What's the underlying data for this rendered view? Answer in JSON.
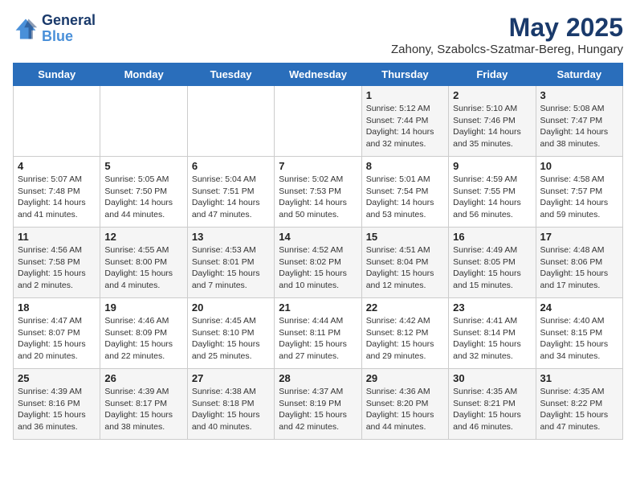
{
  "header": {
    "logo_line1": "General",
    "logo_line2": "Blue",
    "month": "May 2025",
    "location": "Zahony, Szabolcs-Szatmar-Bereg, Hungary"
  },
  "weekdays": [
    "Sunday",
    "Monday",
    "Tuesday",
    "Wednesday",
    "Thursday",
    "Friday",
    "Saturday"
  ],
  "weeks": [
    [
      {
        "day": "",
        "info": ""
      },
      {
        "day": "",
        "info": ""
      },
      {
        "day": "",
        "info": ""
      },
      {
        "day": "",
        "info": ""
      },
      {
        "day": "1",
        "info": "Sunrise: 5:12 AM\nSunset: 7:44 PM\nDaylight: 14 hours\nand 32 minutes."
      },
      {
        "day": "2",
        "info": "Sunrise: 5:10 AM\nSunset: 7:46 PM\nDaylight: 14 hours\nand 35 minutes."
      },
      {
        "day": "3",
        "info": "Sunrise: 5:08 AM\nSunset: 7:47 PM\nDaylight: 14 hours\nand 38 minutes."
      }
    ],
    [
      {
        "day": "4",
        "info": "Sunrise: 5:07 AM\nSunset: 7:48 PM\nDaylight: 14 hours\nand 41 minutes."
      },
      {
        "day": "5",
        "info": "Sunrise: 5:05 AM\nSunset: 7:50 PM\nDaylight: 14 hours\nand 44 minutes."
      },
      {
        "day": "6",
        "info": "Sunrise: 5:04 AM\nSunset: 7:51 PM\nDaylight: 14 hours\nand 47 minutes."
      },
      {
        "day": "7",
        "info": "Sunrise: 5:02 AM\nSunset: 7:53 PM\nDaylight: 14 hours\nand 50 minutes."
      },
      {
        "day": "8",
        "info": "Sunrise: 5:01 AM\nSunset: 7:54 PM\nDaylight: 14 hours\nand 53 minutes."
      },
      {
        "day": "9",
        "info": "Sunrise: 4:59 AM\nSunset: 7:55 PM\nDaylight: 14 hours\nand 56 minutes."
      },
      {
        "day": "10",
        "info": "Sunrise: 4:58 AM\nSunset: 7:57 PM\nDaylight: 14 hours\nand 59 minutes."
      }
    ],
    [
      {
        "day": "11",
        "info": "Sunrise: 4:56 AM\nSunset: 7:58 PM\nDaylight: 15 hours\nand 2 minutes."
      },
      {
        "day": "12",
        "info": "Sunrise: 4:55 AM\nSunset: 8:00 PM\nDaylight: 15 hours\nand 4 minutes."
      },
      {
        "day": "13",
        "info": "Sunrise: 4:53 AM\nSunset: 8:01 PM\nDaylight: 15 hours\nand 7 minutes."
      },
      {
        "day": "14",
        "info": "Sunrise: 4:52 AM\nSunset: 8:02 PM\nDaylight: 15 hours\nand 10 minutes."
      },
      {
        "day": "15",
        "info": "Sunrise: 4:51 AM\nSunset: 8:04 PM\nDaylight: 15 hours\nand 12 minutes."
      },
      {
        "day": "16",
        "info": "Sunrise: 4:49 AM\nSunset: 8:05 PM\nDaylight: 15 hours\nand 15 minutes."
      },
      {
        "day": "17",
        "info": "Sunrise: 4:48 AM\nSunset: 8:06 PM\nDaylight: 15 hours\nand 17 minutes."
      }
    ],
    [
      {
        "day": "18",
        "info": "Sunrise: 4:47 AM\nSunset: 8:07 PM\nDaylight: 15 hours\nand 20 minutes."
      },
      {
        "day": "19",
        "info": "Sunrise: 4:46 AM\nSunset: 8:09 PM\nDaylight: 15 hours\nand 22 minutes."
      },
      {
        "day": "20",
        "info": "Sunrise: 4:45 AM\nSunset: 8:10 PM\nDaylight: 15 hours\nand 25 minutes."
      },
      {
        "day": "21",
        "info": "Sunrise: 4:44 AM\nSunset: 8:11 PM\nDaylight: 15 hours\nand 27 minutes."
      },
      {
        "day": "22",
        "info": "Sunrise: 4:42 AM\nSunset: 8:12 PM\nDaylight: 15 hours\nand 29 minutes."
      },
      {
        "day": "23",
        "info": "Sunrise: 4:41 AM\nSunset: 8:14 PM\nDaylight: 15 hours\nand 32 minutes."
      },
      {
        "day": "24",
        "info": "Sunrise: 4:40 AM\nSunset: 8:15 PM\nDaylight: 15 hours\nand 34 minutes."
      }
    ],
    [
      {
        "day": "25",
        "info": "Sunrise: 4:39 AM\nSunset: 8:16 PM\nDaylight: 15 hours\nand 36 minutes."
      },
      {
        "day": "26",
        "info": "Sunrise: 4:39 AM\nSunset: 8:17 PM\nDaylight: 15 hours\nand 38 minutes."
      },
      {
        "day": "27",
        "info": "Sunrise: 4:38 AM\nSunset: 8:18 PM\nDaylight: 15 hours\nand 40 minutes."
      },
      {
        "day": "28",
        "info": "Sunrise: 4:37 AM\nSunset: 8:19 PM\nDaylight: 15 hours\nand 42 minutes."
      },
      {
        "day": "29",
        "info": "Sunrise: 4:36 AM\nSunset: 8:20 PM\nDaylight: 15 hours\nand 44 minutes."
      },
      {
        "day": "30",
        "info": "Sunrise: 4:35 AM\nSunset: 8:21 PM\nDaylight: 15 hours\nand 46 minutes."
      },
      {
        "day": "31",
        "info": "Sunrise: 4:35 AM\nSunset: 8:22 PM\nDaylight: 15 hours\nand 47 minutes."
      }
    ]
  ]
}
